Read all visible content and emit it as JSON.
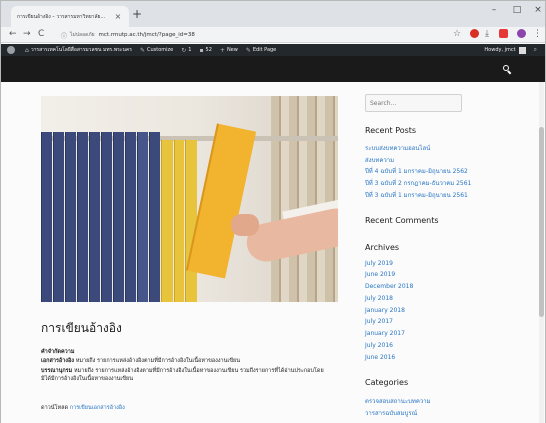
{
  "browser": {
    "tab_title": "การเขียนอ้างอิง – วารสารมหาวิทยาลัย...",
    "tab_close": "×",
    "new_tab": "+",
    "minimize": "–",
    "maximize": "□",
    "close": "×",
    "back": "←",
    "forward": "→",
    "reload": "C",
    "secure_label": "ไม่ปลอดภัย",
    "url": "mct.rmutp.ac.th/jmct/?page_id=38"
  },
  "admin_bar": {
    "site_name": "วารสารเทคโนโลยีสื่อสารมวลชน มทร.พระนคร",
    "customize": "Customize",
    "updates": "1",
    "comments": "52",
    "new": "New",
    "edit_page": "Edit Page",
    "howdy": "Howdy, jmct"
  },
  "post": {
    "title": "การเขียนอ้างอิง",
    "section_label": "คำจำกัดความ",
    "para1_label": "เอกสารอ้างอิง",
    "para1_text": "หมายถึง รายการแหล่งอ้างอิงตามที่มีการอ้างอิงในเนื้อหาของงานเขียน",
    "para2_label": "บรรณานุกรม",
    "para2_text": "หมายถึง รายการแหล่งอ้างอิงตามที่มีการอ้างอิงในเนื้อหาของงานเขียน รวมถึงรายการที่ได้อ่านประกอบโดยมิได้มีการอ้างอิงในเนื้อหาของงานเขียน",
    "download_label": "ดาวน์โหลด",
    "download_link": "การเขียนเอกสารอ้างอิง"
  },
  "sidebar": {
    "search_placeholder": "Search...",
    "recent_posts_title": "Recent Posts",
    "recent_posts": [
      "ระบบส่งบทความออนไลน์",
      "ส่งบทความ",
      "ปีที่ 4 ฉบับที่ 1 มกราคม-มิถุนายน 2562",
      "ปีที่ 3 ฉบับที่ 2 กรกฎาคม-ธันวาคม 2561",
      "ปีที่ 3 ฉบับที่ 1 มกราคม-มิถุนายน 2561"
    ],
    "recent_comments_title": "Recent Comments",
    "archives_title": "Archives",
    "archives": [
      "July 2019",
      "June 2019",
      "December 2018",
      "July 2018",
      "January 2018",
      "July 2017",
      "January 2017",
      "July 2016",
      "June 2016"
    ],
    "categories_title": "Categories",
    "categories": [
      "ตรวจสอบสถานะบทความ",
      "วารสารฉบับสมบูรณ์"
    ]
  }
}
